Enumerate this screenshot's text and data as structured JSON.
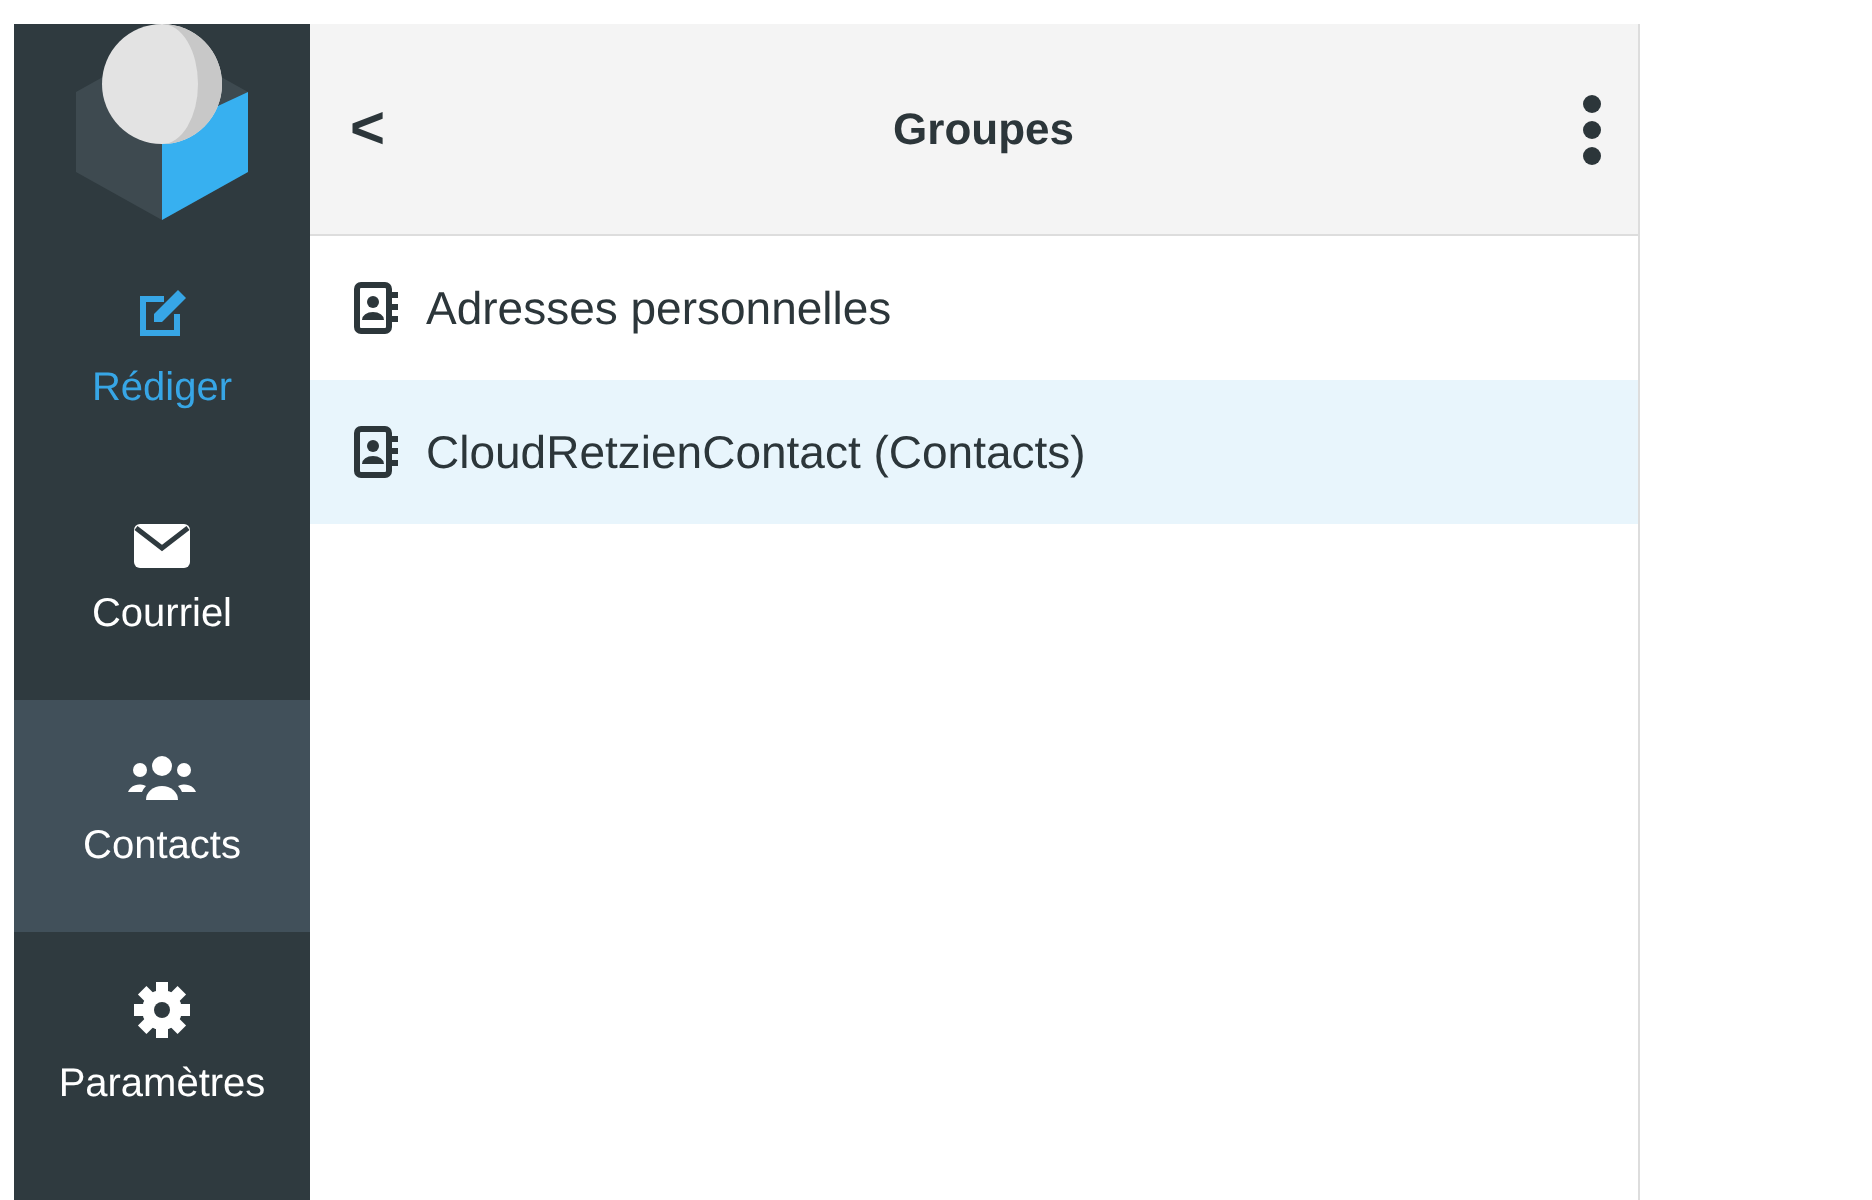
{
  "nav": [
    {
      "kind": "compose",
      "label": "Rédiger",
      "selected": false
    },
    {
      "kind": "mail",
      "label": "Courriel",
      "selected": false
    },
    {
      "kind": "contacts",
      "label": "Contacts",
      "selected": true
    },
    {
      "kind": "settings",
      "label": "Paramètres",
      "selected": false
    }
  ],
  "panel": {
    "title": "Groupes",
    "back": "<"
  },
  "groups": [
    {
      "label": "Adresses personnelles",
      "selected": false
    },
    {
      "label": "CloudRetzienContact (Contacts)",
      "selected": true
    }
  ]
}
